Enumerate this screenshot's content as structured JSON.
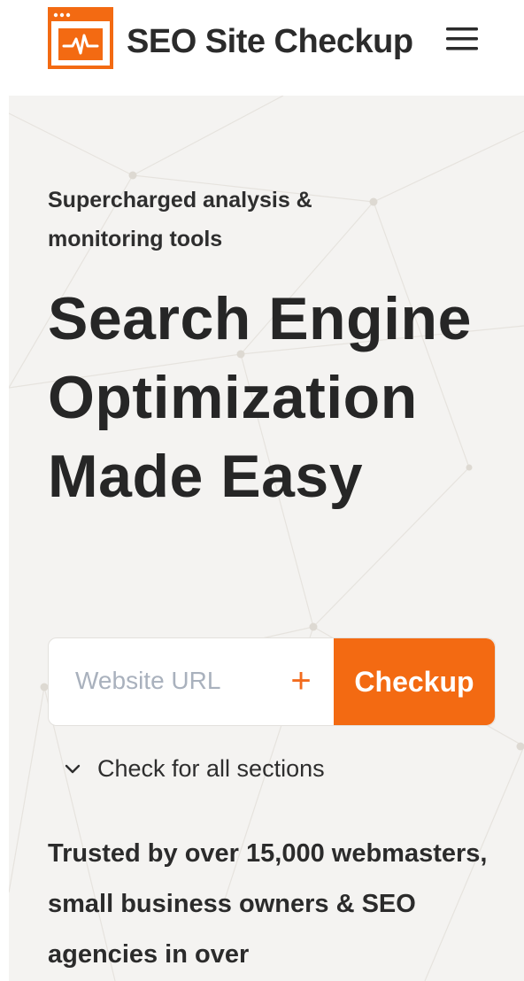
{
  "header": {
    "brand_name": "SEO Site Checkup",
    "logo_icon": "browser-pulse-logo-icon",
    "menu_icon": "hamburger-menu-icon",
    "accent_color": "#f36a12"
  },
  "hero": {
    "kicker": "Supercharged analysis & monitoring tools",
    "headline": "Search Engine Optimization Made Easy",
    "search": {
      "placeholder": "Website URL",
      "value": "",
      "add_icon": "plus-icon",
      "button_label": "Checkup"
    },
    "sections_toggle": {
      "icon": "chevron-down-icon",
      "label": "Check for all sections"
    },
    "trusted_text": "Trusted by over 15,000 webmasters, small business owners & SEO agencies in over"
  }
}
